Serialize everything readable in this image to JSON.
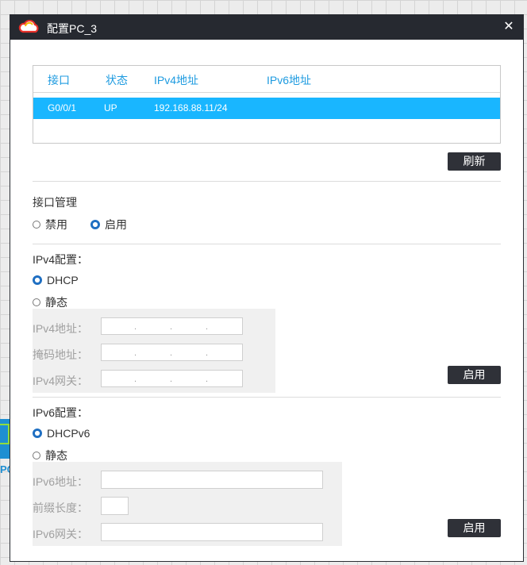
{
  "dialog": {
    "title": "配置PC_3",
    "close_label": "✕"
  },
  "background": {
    "device_label": "PC"
  },
  "interfaces": {
    "headers": [
      "接口",
      "状态",
      "IPv4地址",
      "IPv6地址"
    ],
    "rows": [
      {
        "port": "G0/0/1",
        "status": "UP",
        "ipv4": "192.168.88.11/24",
        "ipv6": ""
      }
    ],
    "refresh_label": "刷新"
  },
  "iface_mgmt": {
    "title": "接口管理",
    "options": [
      "禁用",
      "启用"
    ],
    "selected": "启用"
  },
  "ipv4": {
    "title": "IPv4配置：",
    "options": [
      "DHCP",
      "静态"
    ],
    "selected": "DHCP",
    "fields": [
      "IPv4地址：",
      "掩码地址：",
      "IPv4网关："
    ],
    "apply_label": "启用"
  },
  "ipv6": {
    "title": "IPv6配置：",
    "options": [
      "DHCPv6",
      "静态"
    ],
    "selected": "DHCPv6",
    "fields": [
      "IPv6地址：",
      "前缀长度：",
      "IPv6网关："
    ],
    "apply_label": "启用"
  },
  "colors": {
    "header_text": "#1e9be0",
    "selected_row": "#19b6ff",
    "titlebar": "#262930",
    "button": "#2f3138",
    "radio_on": "#1f6fc2"
  },
  "icons": {
    "title": "cloud-icon",
    "close": "close-icon"
  }
}
